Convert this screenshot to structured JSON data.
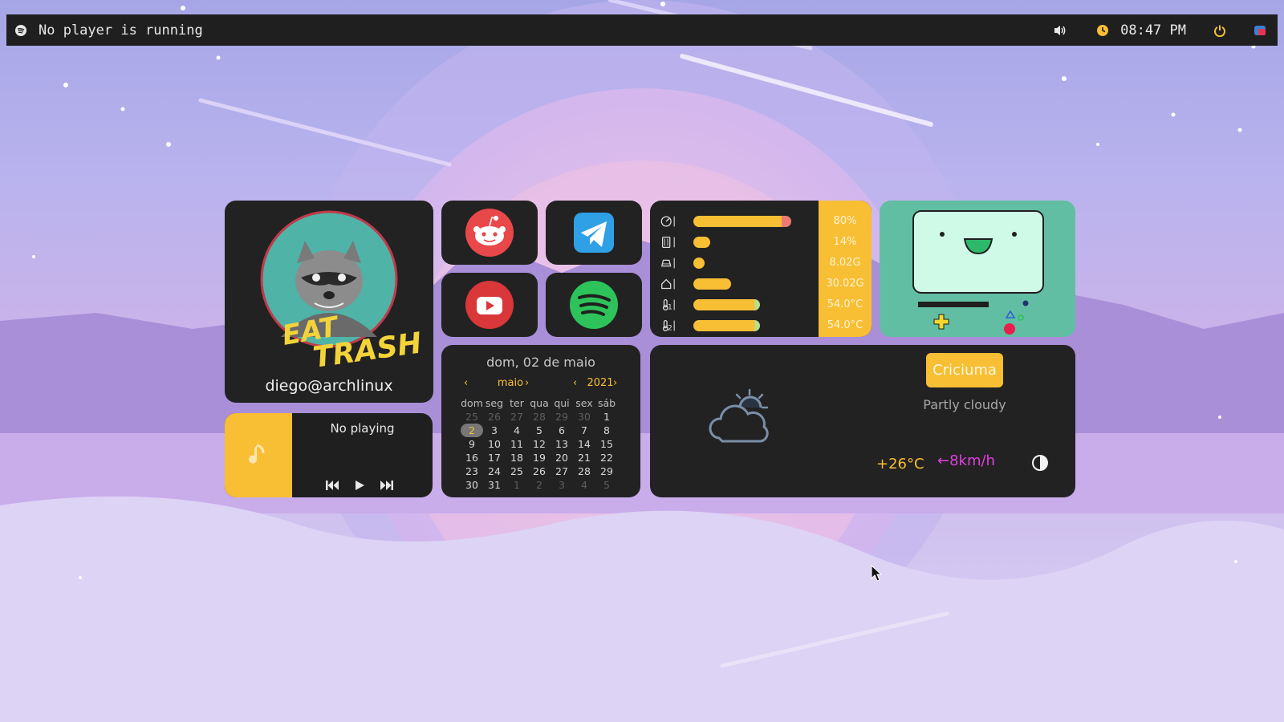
{
  "topbar": {
    "player_status": "No player is running",
    "time": "08:47 PM",
    "icons": [
      "spotify-icon",
      "volume-icon",
      "clock-icon",
      "power-icon",
      "notification-icon"
    ],
    "accent": "#f8be34"
  },
  "profile": {
    "username": "diego@archlinux",
    "avatar_text": [
      "EAT",
      "TRASH"
    ]
  },
  "music": {
    "title": "No playing",
    "controls": [
      "previous",
      "play",
      "next"
    ]
  },
  "apps": [
    "reddit",
    "telegram",
    "youtube",
    "spotify"
  ],
  "calendar": {
    "header": "dom, 02 de maio",
    "month": "maio",
    "year": "2021",
    "weekdays": [
      "dom",
      "seg",
      "ter",
      "qua",
      "qui",
      "sex",
      "sáb"
    ],
    "weeks": [
      [
        "25",
        "26",
        "27",
        "28",
        "29",
        "30",
        "1"
      ],
      [
        "2",
        "3",
        "4",
        "5",
        "6",
        "7",
        "8"
      ],
      [
        "9",
        "10",
        "11",
        "12",
        "13",
        "14",
        "15"
      ],
      [
        "16",
        "17",
        "18",
        "19",
        "20",
        "21",
        "22"
      ],
      [
        "23",
        "24",
        "25",
        "26",
        "27",
        "28",
        "29"
      ],
      [
        "30",
        "31",
        "1",
        "2",
        "3",
        "4",
        "5"
      ]
    ],
    "today": "2"
  },
  "stats": [
    {
      "icon": "cpu-gauge-icon",
      "value": "80%",
      "level": 0.97
    },
    {
      "icon": "memory-icon",
      "value": "14%",
      "level": 0.17
    },
    {
      "icon": "disk-icon",
      "value": "8.02G",
      "level": 0.1
    },
    {
      "icon": "home-icon",
      "value": "30.02G",
      "level": 0.37
    },
    {
      "icon": "temp1-icon",
      "value": "54.0°C",
      "level": 0.66
    },
    {
      "icon": "temp2-icon",
      "value": "54.0°C",
      "level": 0.66
    }
  ],
  "weather": {
    "city": "Criciuma",
    "condition": "Partly cloudy",
    "temperature": "+26°C",
    "wind": "←8km/h"
  }
}
